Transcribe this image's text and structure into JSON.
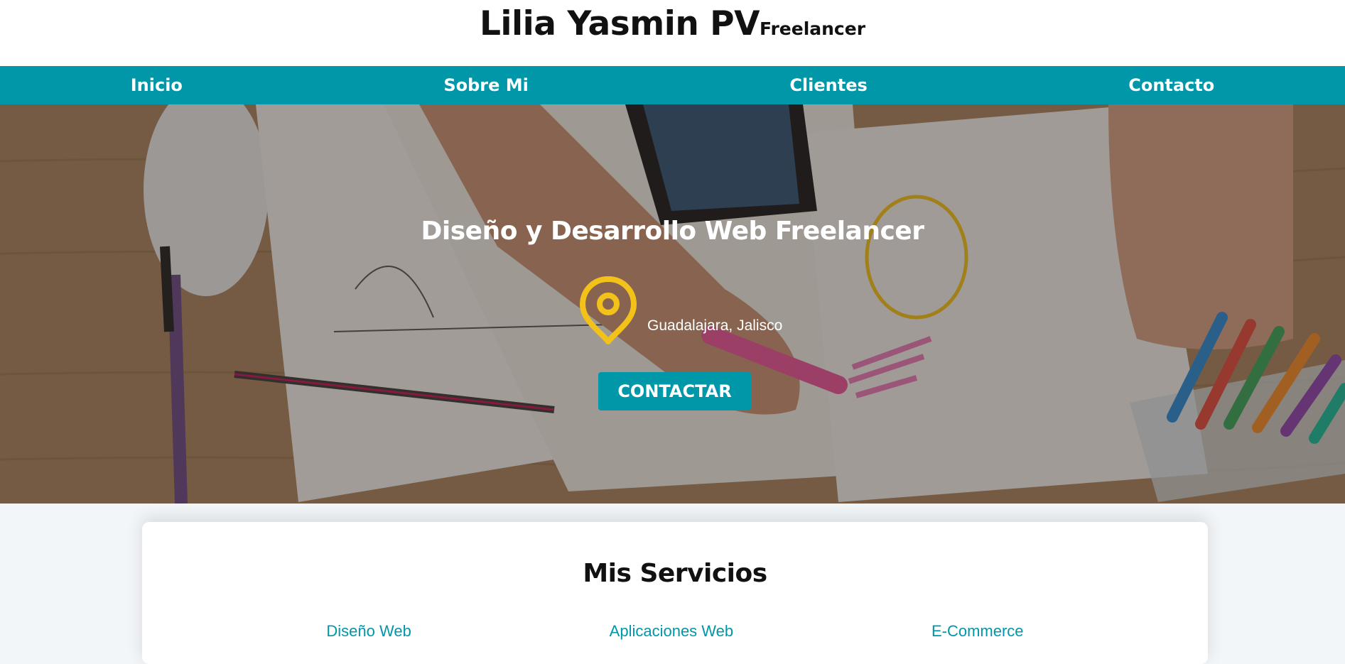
{
  "header": {
    "title": "Lilia Yasmin PV",
    "subtitle": "Freelancer"
  },
  "nav": {
    "items": [
      {
        "label": "Inicio"
      },
      {
        "label": "Sobre Mi"
      },
      {
        "label": "Clientes"
      },
      {
        "label": "Contacto"
      }
    ]
  },
  "hero": {
    "title": "Diseño y Desarrollo Web Freelancer",
    "location": "Guadalajara, Jalisco",
    "location_icon": "map-pin-icon",
    "cta_label": "CONTACTAR"
  },
  "services": {
    "title": "Mis Servicios",
    "items": [
      {
        "label": "Diseño Web"
      },
      {
        "label": "Aplicaciones Web"
      },
      {
        "label": "E-Commerce"
      }
    ]
  },
  "colors": {
    "primary": "#0097a9",
    "accent": "#f2c21b",
    "white": "#ffffff"
  }
}
